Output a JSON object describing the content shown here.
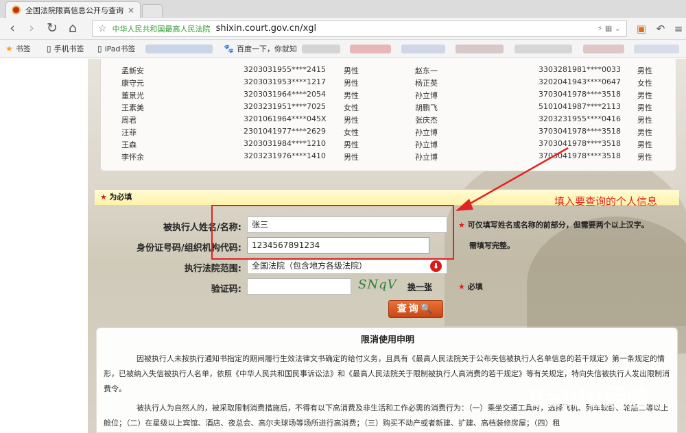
{
  "browser": {
    "tab_title": "全国法院限高信息公开与查询",
    "tab_close": "×",
    "back": "‹",
    "forward": "›",
    "reload": "↻",
    "home": "⌂",
    "star": "☆",
    "site_name": "中华人民共和国最高人民法院",
    "url": "shixin.court.gov.cn/xgl",
    "addr_icons": "⚡  ▦  ⌄",
    "bookmarks": [
      {
        "icon": "★",
        "label": "书签"
      },
      {
        "icon": "▯",
        "label": "手机书签"
      },
      {
        "icon": "▯",
        "label": "iPad书签"
      },
      {
        "icon": "🐾",
        "label": "百度一下，你就知"
      }
    ]
  },
  "list": {
    "rows": [
      {
        "name1": "孟新安",
        "id1": "3203031955****2415",
        "sex1": "男性",
        "name2": "赵东一",
        "id2": "3303281981****0033",
        "sex2": "男性"
      },
      {
        "name1": "康守元",
        "id1": "3203031953****1217",
        "sex1": "男性",
        "name2": "杨正英",
        "id2": "3202041943****0647",
        "sex2": "女性"
      },
      {
        "name1": "董景光",
        "id1": "3203031964****2054",
        "sex1": "男性",
        "name2": "孙立博",
        "id2": "3703041978****3518",
        "sex2": "男性"
      },
      {
        "name1": "王素美",
        "id1": "3203231951****7025",
        "sex1": "女性",
        "name2": "胡鹏飞",
        "id2": "5101041987****2113",
        "sex2": "男性"
      },
      {
        "name1": "周君",
        "id1": "3201061964****045X",
        "sex1": "男性",
        "name2": "张庆杰",
        "id2": "3203231955****0416",
        "sex2": "男性"
      },
      {
        "name1": "汪菲",
        "id1": "2301041977****2629",
        "sex1": "女性",
        "name2": "孙立博",
        "id2": "3703041978****3518",
        "sex2": "男性"
      },
      {
        "name1": "王森",
        "id1": "3203031984****1210",
        "sex1": "男性",
        "name2": "孙立博",
        "id2": "3703041978****3518",
        "sex2": "男性"
      },
      {
        "name1": "李怀余",
        "id1": "3203231976****1410",
        "sex1": "男性",
        "name2": "孙立博",
        "id2": "3703041978****3518",
        "sex2": "男性"
      }
    ]
  },
  "form": {
    "required_mark": "★",
    "required_text": "为必填",
    "name_label": "被执行人姓名/名称:",
    "name_value": "张三",
    "name_hint": "可仅填写姓名或名称的前部分，但需要两个以上汉字。",
    "id_label": "身份证号码/组织机构代码:",
    "id_value": "1234567891234",
    "id_hint": "需填写完整。",
    "court_label": "执行法院范围:",
    "court_value": "全国法院（包含地方各级法院）",
    "dropdown_glyph": "⬇",
    "captcha_label": "验证码:",
    "captcha_text": "SNqV",
    "swap_label": "换一张",
    "captcha_required": "必填",
    "query_button": "查询",
    "query_glyph": "🔍"
  },
  "annotation": "填入要查询的个人信息",
  "notice": {
    "title": "限消使用申明",
    "para1": "因被执行人未按执行通知书指定的期间履行生效法律文书确定的给付义务，且具有《最高人民法院关于公布失信被执行人名单信息的若干规定》第一条规定的情形，已被纳入失信被执行人名单，依照《中华人民共和国民事诉讼法》和《最高人民法院关于限制被执行人高消费的若干规定》等有关规定，特向失信被执行人发出限制消费令。",
    "para2": "被执行人为自然人的，被采取限制消费措施后，不得有以下高消费及非生活和工作必需的消费行为：（一）乘坐交通工具时，选择飞机、列车软卧、轮船二等以上舱位；（二）在星级以上宾馆、酒店、夜总会、高尔夫球场等场所进行高消费；（三）购买不动产或者新建、扩建、高档装修房屋；（四）租"
  },
  "watermark": "Baidu经验"
}
